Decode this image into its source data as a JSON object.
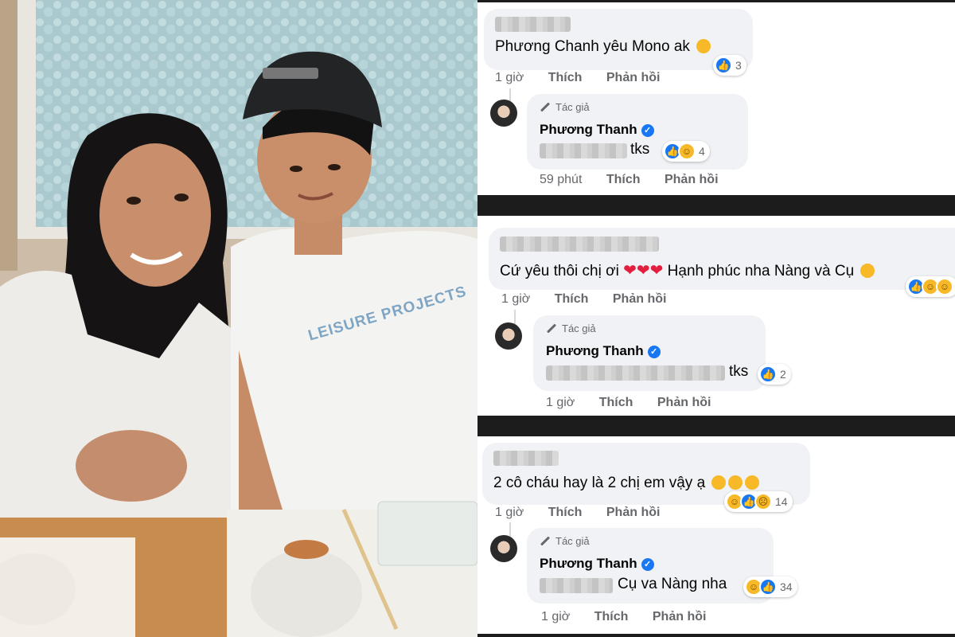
{
  "photo": {
    "shirt_text": "LEISURE PROJECTS"
  },
  "comments": [
    {
      "comment_text": "Phương Chanh yêu Mono ak",
      "meta": {
        "time": "1 giờ",
        "like": "Thích",
        "reply": "Phản hồi"
      },
      "reactions": {
        "icons": [
          "like-icon"
        ],
        "count": "3"
      },
      "reply": {
        "author_badge": "Tác giả",
        "name": "Phương Thanh",
        "text": "tks",
        "reactions": {
          "icons": [
            "like-icon",
            "haha-icon"
          ],
          "count": "4"
        },
        "meta": {
          "time": "59 phút",
          "like": "Thích",
          "reply": "Phản hồi"
        }
      }
    },
    {
      "comment_text_a": "Cứ yêu thôi chị ơi",
      "comment_text_b": "Hạnh phúc nha Nàng và Cụ",
      "meta": {
        "time": "1 giờ",
        "like": "Thích",
        "reply": "Phản hồi"
      },
      "reactions": {
        "icons": [
          "like-icon",
          "haha-icon",
          "haha-icon"
        ],
        "count": ""
      },
      "reply": {
        "author_badge": "Tác giả",
        "name": "Phương Thanh",
        "text": "tks",
        "reactions": {
          "icons": [
            "like-icon"
          ],
          "count": "2"
        },
        "meta": {
          "time": "1 giờ",
          "like": "Thích",
          "reply": "Phản hồi"
        }
      }
    },
    {
      "comment_text": "2 cô cháu hay là 2 chị em vậy ạ",
      "meta": {
        "time": "1 giờ",
        "like": "Thích",
        "reply": "Phản hồi"
      },
      "reactions": {
        "icons": [
          "haha-icon",
          "like-icon",
          "sad-icon"
        ],
        "count": "14"
      },
      "reply": {
        "author_badge": "Tác giả",
        "name": "Phương Thanh",
        "text": "Cụ va Nàng nha",
        "reactions": {
          "icons": [
            "haha-icon",
            "like-icon"
          ],
          "count": "34"
        },
        "meta": {
          "time": "1 giờ",
          "like": "Thích",
          "reply": "Phản hồi"
        }
      }
    }
  ],
  "colors": {
    "facebook_blue": "#1877f2",
    "bubble": "#f0f2f5",
    "meta_text": "#65676b",
    "heart": "#e41e3f"
  }
}
